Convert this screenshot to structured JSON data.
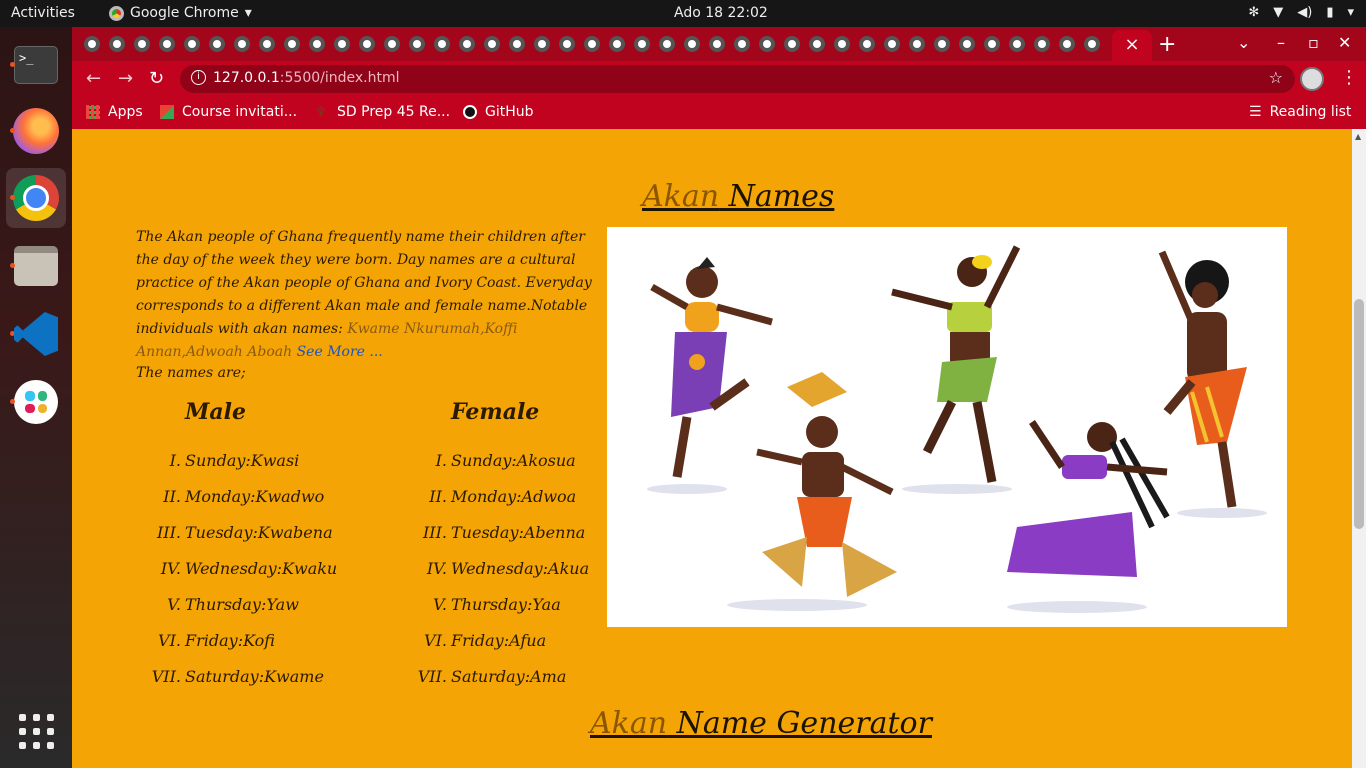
{
  "topbar": {
    "activities": "Activities",
    "app_name": "Google Chrome",
    "clock": "Ado 18  22:02"
  },
  "dock": {
    "items": [
      "terminal-icon",
      "firefox-icon",
      "chrome-icon",
      "files-icon",
      "vscode-icon",
      "slack-icon",
      "app-grid-icon"
    ]
  },
  "browser": {
    "tab_close": "×",
    "new_tab": "+",
    "url_host": "127.0.0.1",
    "url_path": ":5500/index.html",
    "bookmarks": [
      {
        "label": "Apps"
      },
      {
        "label": "Course invitati..."
      },
      {
        "label": "SD Prep 45 Re..."
      },
      {
        "label": "GitHub"
      }
    ],
    "reading_list": "Reading list"
  },
  "page": {
    "title_accent": "Akan",
    "title_rest": " Names",
    "intro_text": "The Akan people of Ghana frequently name their children after the day of the week they were born. Day names are a cultural practice of the Akan people of Ghana and Ivory Coast. Everyday corresponds to a different Akan male and female name.Notable individuals with akan names: ",
    "notable_names": "Kwame Nkurumah,Koffi Annan,Adwoah Aboah",
    "see_more": "See More ...",
    "names_intro": "The names are;",
    "male_heading": "Male",
    "female_heading": "Female",
    "male_names": [
      {
        "num": "I.",
        "text": "Sunday:Kwasi"
      },
      {
        "num": "II.",
        "text": "Monday:Kwadwo"
      },
      {
        "num": "III.",
        "text": "Tuesday:Kwabena"
      },
      {
        "num": "IV.",
        "text": "Wednesday:Kwaku"
      },
      {
        "num": "V.",
        "text": "Thursday:Yaw"
      },
      {
        "num": "VI.",
        "text": "Friday:Kofi"
      },
      {
        "num": "VII.",
        "text": "Saturday:Kwame"
      }
    ],
    "female_names": [
      {
        "num": "I.",
        "text": "Sunday:Akosua"
      },
      {
        "num": "II.",
        "text": "Monday:Adwoa"
      },
      {
        "num": "III.",
        "text": "Tuesday:Abenna"
      },
      {
        "num": "IV.",
        "text": "Wednesday:Akua"
      },
      {
        "num": "V.",
        "text": "Thursday:Yaa"
      },
      {
        "num": "VI.",
        "text": "Friday:Afua"
      },
      {
        "num": "VII.",
        "text": "Saturday:Ama"
      }
    ],
    "generator_accent": "Akan",
    "generator_rest": " Name Generator"
  },
  "colors": {
    "page_bg": "#f4a404",
    "chrome_theme": "#c2031f",
    "link": "#1a55c4"
  }
}
